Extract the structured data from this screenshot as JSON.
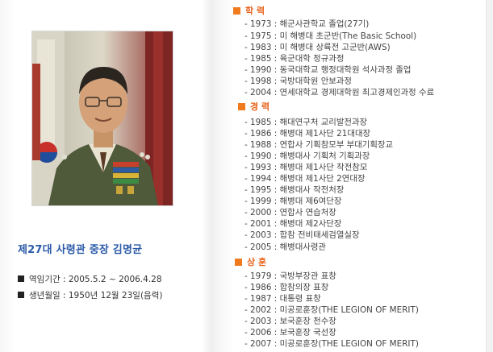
{
  "profile": {
    "title": "제27대 사령관 중장 김명균",
    "tenure": "역임기간 : 2005.5.2 ~ 2006.4.28",
    "birth": "생년월일 : 1950년 12월 23일(음력)"
  },
  "sections": {
    "education": {
      "heading": "학 력",
      "items": [
        "- 1973 : 해군사관학교 졸업(27기)",
        "- 1975 : 미 해병대 초군반(The Basic School)",
        "- 1983 : 미 해병대 상륙전 고군반(AWS)",
        "- 1985 : 육군대학 정규과정",
        "- 1990 : 동국대학교 행정대학원 석사과정 졸업",
        "- 1998 : 국방대학원 안보과정",
        "- 2004 : 연세대학교 경제대학원 최고경제인과정 수료"
      ]
    },
    "career": {
      "heading": "경 력",
      "items": [
        "- 1985 : 해대연구처 교리발전과장",
        "- 1986 : 해병대 제1사단 21대대장",
        "- 1988 : 연합사 기획참모부 부대기획장교",
        "- 1990 : 해병대사 기획처 기획과장",
        "- 1993 : 해병대 제1사단 작전참모",
        "- 1994 : 해병대 제1사단 2연대장",
        "- 1995 : 해병대사 작전처장",
        "- 1999 : 해병대 제6여단장",
        "- 2000 : 연합사 연습처장",
        "- 2001 : 해병대 제2사단장",
        "- 2003 : 합참 전비태세검열실장",
        "- 2005 : 해병대사령관"
      ]
    },
    "awards": {
      "heading": "상 훈",
      "items": [
        "- 1979 : 국방부장관 표창",
        "- 1986 : 합참의장 표창",
        "- 1987 : 대통령 표창",
        "- 2002 : 미공로훈장(THE LEGION OF MERIT)",
        "- 2003 : 보국훈장 천수장",
        "- 2006 : 보국훈장 국선장",
        "- 2007 : 미공로훈장(THE LEGION OF MERIT)"
      ]
    }
  },
  "colors": {
    "accent_orange": "#f07a1e",
    "title_blue": "#2b5aa8"
  }
}
